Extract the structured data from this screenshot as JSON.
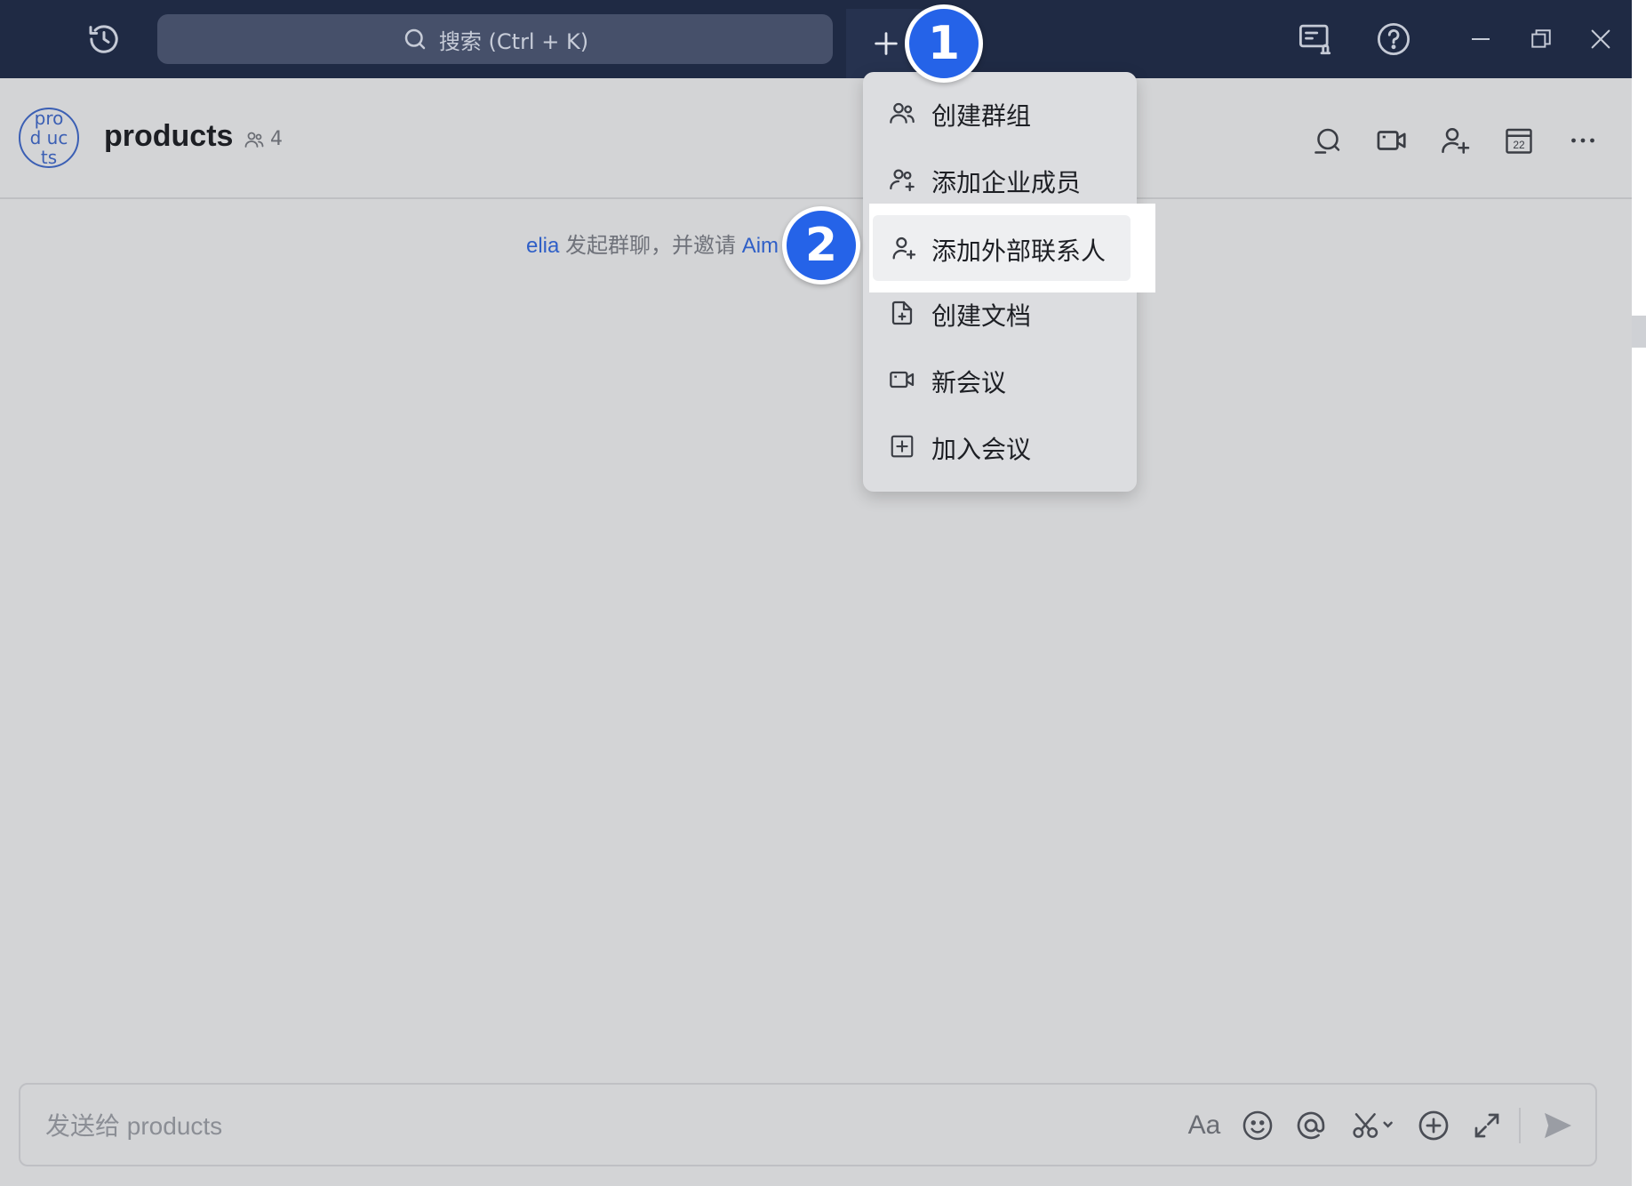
{
  "titlebar": {
    "search_placeholder": "搜索 (Ctrl + K)",
    "history_icon": "history-icon",
    "notification_icon": "notification-monitor-icon",
    "help_icon": "help-icon",
    "plus_icon": "plus-icon"
  },
  "chat": {
    "avatar_text": "prod ucts",
    "title": "products",
    "member_count": "4",
    "system_message": {
      "actor": "elia",
      "text": "发起群聊，并邀请",
      "invitee": "Aim"
    }
  },
  "menu": {
    "items": [
      {
        "label": "创建群组",
        "icon": "group-icon"
      },
      {
        "label": "添加企业成员",
        "icon": "add-members-icon"
      },
      {
        "label": "添加外部联系人",
        "icon": "add-contact-icon"
      },
      {
        "label": "创建文档",
        "icon": "new-doc-icon"
      },
      {
        "label": "新会议",
        "icon": "video-icon"
      },
      {
        "label": "加入会议",
        "icon": "join-meeting-icon"
      }
    ]
  },
  "annotations": {
    "step1": "1",
    "step2": "2"
  },
  "composer": {
    "placeholder": "发送给 products",
    "format_label": "Aa"
  },
  "colors": {
    "titlebar_bg": "#1f2a44",
    "accent": "#2563e8",
    "link": "#2f5fc7"
  }
}
